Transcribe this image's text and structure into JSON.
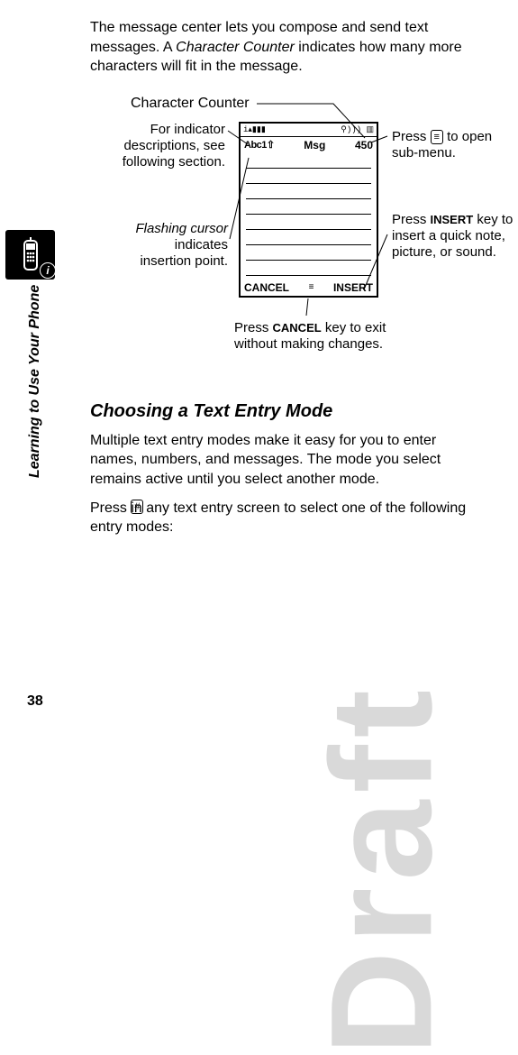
{
  "watermark": "Draft",
  "page_number": "38",
  "side_section": "Learning to Use Your Phone",
  "intro_before_em": "The message center lets you compose and send text messages. A ",
  "intro_em": "Character Counter",
  "intro_after_em": " indicates how many more characters will fit in the message.",
  "diagram": {
    "counter_heading": "Character Counter",
    "indicator_label": "For indicator descriptions, see following section.",
    "cursor_label_em": "Flashing cursor",
    "cursor_label_rest": " indicates insertion point.",
    "menu_label_before": "Press ",
    "menu_label_after": " to open sub-menu.",
    "menu_glyph": "≡",
    "insert_label_before": "Press ",
    "insert_label_key": "INSERT",
    "insert_label_after": " key to insert a quick note, picture, or sound.",
    "cancel_label_before": "Press ",
    "cancel_label_key": "CANCEL",
    "cancel_label_after": " key to exit without making changes."
  },
  "screen": {
    "mode_indicator": "Abc1⇧",
    "title": "Msg",
    "counter_value": "450",
    "left_softkey": "CANCEL",
    "right_softkey": "INSERT",
    "menu_icon": "≡"
  },
  "subheading": "Choosing a Text Entry Mode",
  "modes_para": "Multiple text entry modes make it easy for you to enter names, numbers, and messages. The mode you select remains active until you select another mode.",
  "press_para_before": "Press ",
  "press_key_glyph": "#",
  "press_para_after": " in any text entry screen to select one of the following entry modes:"
}
